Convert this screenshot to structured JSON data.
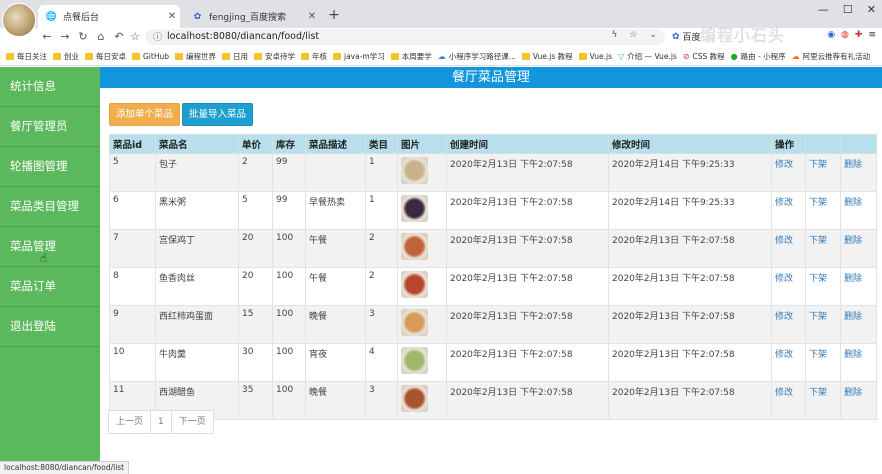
{
  "browser": {
    "tabs": [
      {
        "title": "点餐后台",
        "active": true
      },
      {
        "title": "fengjing_百度搜索",
        "active": false
      }
    ],
    "url": "localhost:8080/diancan/food/list",
    "search_chip": "百度",
    "watermark": "编程小石头",
    "status_url": "localhost:8080/diancan/food/list",
    "bookmarks": [
      {
        "label": "每日关注",
        "icon": "folder"
      },
      {
        "label": "创业",
        "icon": "folder"
      },
      {
        "label": "每日安卓",
        "icon": "folder"
      },
      {
        "label": "GitHub",
        "icon": "folder"
      },
      {
        "label": "编程世界",
        "icon": "folder"
      },
      {
        "label": "日用",
        "icon": "folder"
      },
      {
        "label": "安卓待学",
        "icon": "folder"
      },
      {
        "label": "年核",
        "icon": "folder"
      },
      {
        "label": "java-m学习",
        "icon": "folder"
      },
      {
        "label": "本周要学",
        "icon": "folder"
      },
      {
        "label": "小程序学习路径课...",
        "icon": "cloud"
      },
      {
        "label": "Vue.js 教程",
        "icon": "folder"
      },
      {
        "label": "Vue.js",
        "icon": "folder"
      },
      {
        "label": "介绍 — Vue.js",
        "icon": "vue"
      },
      {
        "label": "CSS 教程",
        "icon": "cross"
      },
      {
        "label": "路由 - 小程序",
        "icon": "wechat"
      },
      {
        "label": "阿里云推荐有礼活动",
        "icon": "cloud-orange"
      }
    ]
  },
  "sidebar": {
    "items": [
      "统计信息",
      "餐厅管理员",
      "轮播图管理",
      "菜品类目管理",
      "菜品管理",
      "菜品订单",
      "退出登陆"
    ]
  },
  "header": {
    "title": "餐厅菜品管理"
  },
  "toolbar": {
    "add_label": "添加单个菜品",
    "import_label": "批量导入菜品"
  },
  "table": {
    "headers": [
      "菜品id",
      "菜品名",
      "单价",
      "库存",
      "菜品描述",
      "类目",
      "图片",
      "创建时间",
      "修改时间",
      "操作",
      "",
      ""
    ],
    "actions": {
      "edit": "修改",
      "offline": "下架",
      "delete": "删除"
    },
    "rows": [
      {
        "id": "5",
        "name": "包子",
        "price": "2",
        "stock": "99",
        "desc": "",
        "category": "1",
        "created": "2020年2月13日 下午2:07:58",
        "updated": "2020年2月14日 下午9:25:33",
        "img_color": "#c9b28a"
      },
      {
        "id": "6",
        "name": "黑米粥",
        "price": "5",
        "stock": "99",
        "desc": "早餐热卖",
        "category": "1",
        "created": "2020年2月13日 下午2:07:58",
        "updated": "2020年2月14日 下午9:25:33",
        "img_color": "#3b2a3f"
      },
      {
        "id": "7",
        "name": "宫保鸡丁",
        "price": "20",
        "stock": "100",
        "desc": "午餐",
        "category": "2",
        "created": "2020年2月13日 下午2:07:58",
        "updated": "2020年2月13日 下午2:07:58",
        "img_color": "#c0643a"
      },
      {
        "id": "8",
        "name": "鱼香肉丝",
        "price": "20",
        "stock": "100",
        "desc": "午餐",
        "category": "2",
        "created": "2020年2月13日 下午2:07:58",
        "updated": "2020年2月13日 下午2:07:58",
        "img_color": "#b8452e"
      },
      {
        "id": "9",
        "name": "西红柿鸡蛋面",
        "price": "15",
        "stock": "100",
        "desc": "晚餐",
        "category": "3",
        "created": "2020年2月13日 下午2:07:58",
        "updated": "2020年2月13日 下午2:07:58",
        "img_color": "#d89a5a"
      },
      {
        "id": "10",
        "name": "牛肉羹",
        "price": "30",
        "stock": "100",
        "desc": "宵夜",
        "category": "4",
        "created": "2020年2月13日 下午2:07:58",
        "updated": "2020年2月13日 下午2:07:58",
        "img_color": "#9fb86a"
      },
      {
        "id": "11",
        "name": "西湖醋鱼",
        "price": "35",
        "stock": "100",
        "desc": "晚餐",
        "category": "3",
        "created": "2020年2月13日 下午2:07:58",
        "updated": "2020年2月13日 下午2:07:58",
        "img_color": "#a8532e"
      }
    ]
  },
  "pagination": {
    "prev": "上一页",
    "current": "1",
    "next": "下一页"
  }
}
